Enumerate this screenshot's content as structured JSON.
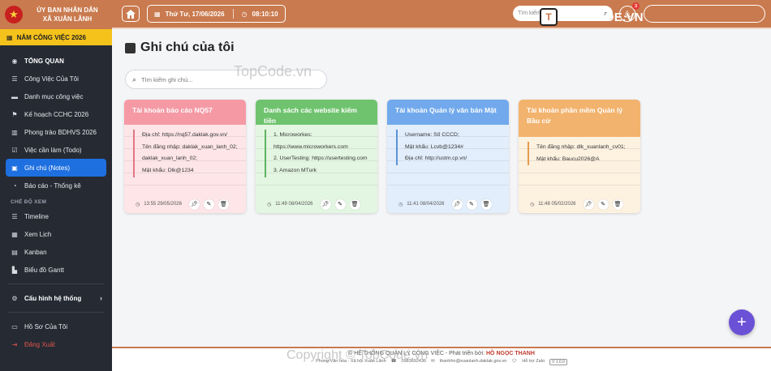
{
  "brand": {
    "line1": "ỦY BAN NHÂN DÂN",
    "line2": "XÃ XUÂN LÃNH"
  },
  "year_bar": "NĂM CÔNG VIỆC 2026",
  "sidebar": {
    "items": [
      {
        "label": "TỔNG QUAN",
        "icon": "dashboard-icon"
      },
      {
        "label": "Công Việc Của Tôi",
        "icon": "list-icon"
      },
      {
        "label": "Danh mục công việc",
        "icon": "folder-icon"
      },
      {
        "label": "Kế hoạch CCHC 2026",
        "icon": "flag-icon"
      },
      {
        "label": "Phong trào BDHVS 2026",
        "icon": "building-icon"
      },
      {
        "label": "Việc cần làm (Todo)",
        "icon": "checkbox-icon"
      },
      {
        "label": "Ghi chú (Notes)",
        "icon": "note-icon"
      },
      {
        "label": "Báo cáo - Thống kê",
        "icon": "chart-icon"
      }
    ],
    "section_view": "CHẾ ĐỘ XEM",
    "view_items": [
      {
        "label": "Timeline",
        "icon": "timeline-icon"
      },
      {
        "label": "Xem Lịch",
        "icon": "calendar-icon"
      },
      {
        "label": "Kanban",
        "icon": "kanban-icon"
      },
      {
        "label": "Biểu đồ Gantt",
        "icon": "gantt-icon"
      }
    ],
    "settings": "Cấu hình hệ thống",
    "profile": "Hồ Sơ Của Tôi",
    "logout": "Đăng Xuất"
  },
  "header": {
    "date": "Thứ Tư, 17/06/2026",
    "time": "08:10:10",
    "search_placeholder": "Tìm kiếm...",
    "notification_count": "3"
  },
  "watermark": {
    "logo_letters": "T",
    "text": "TOPCODE.VN",
    "center": "TopCode.vn",
    "copyright": "Copyright © TopCode.vn"
  },
  "page": {
    "title": "Ghi chú của tôi",
    "search_placeholder": "Tìm kiếm ghi chú..."
  },
  "notes": [
    {
      "title": "Tài khoản báo cáo NQ57",
      "lines": [
        "Địa chỉ: https://nq57.daklak.gov.vn/",
        "Tên đăng nhập: daklak_xuan_lanh_02;",
        "daklak_xuan_lanh_02;",
        "Mật khẩu: Dlk@1234"
      ],
      "timestamp": "13:55 29/05/2026"
    },
    {
      "title": "Danh sách các website kiếm tiền",
      "lines": [
        "1. Microworkes:",
        "https://www.microworkers.com",
        "2. UserTesting: https://usertesting.com",
        "3. Amazon MTurk"
      ],
      "timestamp": "11:49 08/04/2026"
    },
    {
      "title": "Tài khoản Quản lý văn bản Mật",
      "lines": [
        "Username: Số CCCD;",
        "Mật khẩu: Lcvb@1234#",
        "Địa chỉ: http://ustm.cp.vn/"
      ],
      "timestamp": "11:41 08/04/2026"
    },
    {
      "title": "Tài khoản phần mềm Quản lý Bầu cử",
      "lines": [
        "Tên đăng nhập: dlk_xuanlanh_cv01;",
        "Mật khẩu: Baucu2026@A"
      ],
      "timestamp": "11:48 05/02/2026"
    }
  ],
  "footer": {
    "line1_prefix": "© HỆ THỐNG QUẢN LÝ CÔNG VIỆC - Phát triển bởi:",
    "author": "HỒ NGỌC THANH",
    "address": "Phong Văn hóa - Xã hội Xuân Lãnh",
    "phone": "0983692436",
    "email": "thanhhn@xuanlanh.daklak.gov.vn",
    "zalo": "Hỗ trợ Zalo",
    "version": "V 1.0.0"
  }
}
